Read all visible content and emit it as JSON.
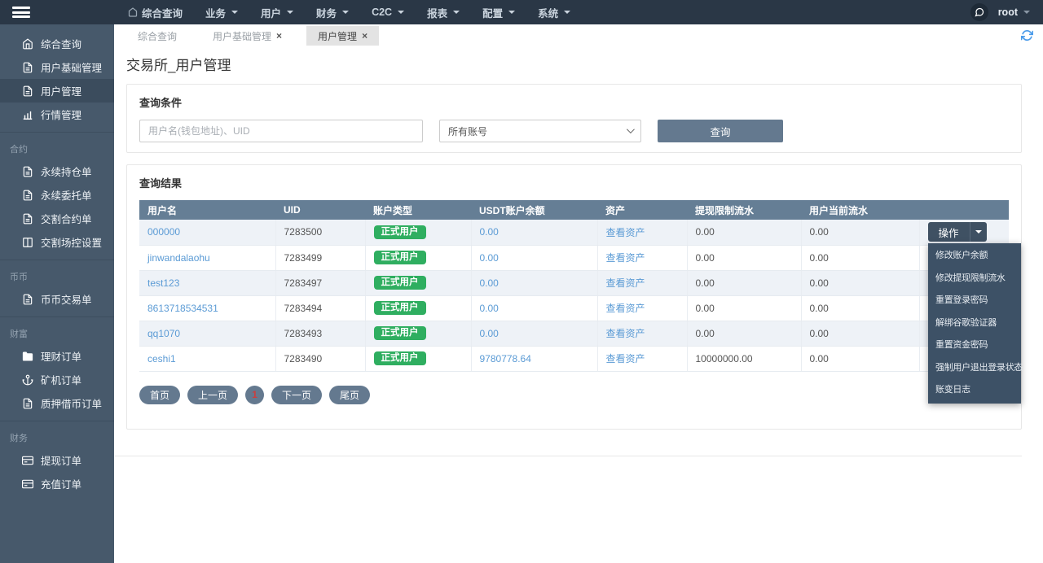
{
  "navbar": {
    "items": [
      {
        "label": "综合查询"
      },
      {
        "label": "业务"
      },
      {
        "label": "用户"
      },
      {
        "label": "财务"
      },
      {
        "label": "C2C"
      },
      {
        "label": "报表"
      },
      {
        "label": "配置"
      },
      {
        "label": "系统"
      }
    ],
    "username": "root"
  },
  "sidebar": {
    "groups": [
      {
        "label": "",
        "items": [
          {
            "label": "综合查询",
            "icon": "home"
          },
          {
            "label": "用户基础管理",
            "icon": "file-text"
          },
          {
            "label": "用户管理",
            "icon": "file-text",
            "active": true
          },
          {
            "label": "行情管理",
            "icon": "bar-chart"
          }
        ]
      },
      {
        "label": "合约",
        "items": [
          {
            "label": "永续持仓单",
            "icon": "file-text"
          },
          {
            "label": "永续委托单",
            "icon": "file-text"
          },
          {
            "label": "交割合约单",
            "icon": "file-text"
          },
          {
            "label": "交割场控设置",
            "icon": "columns"
          }
        ]
      },
      {
        "label": "币币",
        "items": [
          {
            "label": "币币交易单",
            "icon": "file-text"
          }
        ]
      },
      {
        "label": "财富",
        "items": [
          {
            "label": "理财订单",
            "icon": "folder"
          },
          {
            "label": "矿机订单",
            "icon": "anchor"
          },
          {
            "label": "质押借币订单",
            "icon": "file-text"
          }
        ]
      },
      {
        "label": "财务",
        "items": [
          {
            "label": "提现订单",
            "icon": "credit-card"
          },
          {
            "label": "充值订单",
            "icon": "credit-card"
          }
        ]
      }
    ]
  },
  "tabs": {
    "items": [
      {
        "label": "综合查询",
        "closable": false,
        "active": false
      },
      {
        "label": "用户基础管理",
        "closable": true,
        "active": false
      },
      {
        "label": "用户管理",
        "closable": true,
        "active": true
      }
    ]
  },
  "icons": {
    "close": "×"
  },
  "page_title": "交易所_用户管理",
  "search_panel": {
    "title": "查询条件",
    "keyword_placeholder": "用户名(钱包地址)、UID",
    "account_filter_value": "所有账号",
    "search_button_label": "查询"
  },
  "results_panel": {
    "title": "查询结果",
    "columns": [
      "用户名",
      "UID",
      "账户类型",
      "USDT账户余额",
      "资产",
      "提现限制流水",
      "用户当前流水",
      ""
    ],
    "action_button_label": "操作",
    "rows": [
      {
        "username": "000000",
        "uid": "7283500",
        "account_type": "正式用户",
        "usdt_balance": "0.00",
        "assets_link": "查看资产",
        "withdraw_limit_flow": "0.00",
        "current_flow": "0.00"
      },
      {
        "username": "jinwandalaohu",
        "uid": "7283499",
        "account_type": "正式用户",
        "usdt_balance": "0.00",
        "assets_link": "查看资产",
        "withdraw_limit_flow": "0.00",
        "current_flow": "0.00"
      },
      {
        "username": "test123",
        "uid": "7283497",
        "account_type": "正式用户",
        "usdt_balance": "0.00",
        "assets_link": "查看资产",
        "withdraw_limit_flow": "0.00",
        "current_flow": "0.00"
      },
      {
        "username": "8613718534531",
        "uid": "7283494",
        "account_type": "正式用户",
        "usdt_balance": "0.00",
        "assets_link": "查看资产",
        "withdraw_limit_flow": "0.00",
        "current_flow": "0.00"
      },
      {
        "username": "qq1070",
        "uid": "7283493",
        "account_type": "正式用户",
        "usdt_balance": "0.00",
        "assets_link": "查看资产",
        "withdraw_limit_flow": "0.00",
        "current_flow": "0.00"
      },
      {
        "username": "ceshi1",
        "uid": "7283490",
        "account_type": "正式用户",
        "usdt_balance": "9780778.64",
        "assets_link": "查看资产",
        "withdraw_limit_flow": "10000000.00",
        "current_flow": "0.00"
      }
    ],
    "action_menu": [
      "修改账户余额",
      "修改提现限制流水",
      "重置登录密码",
      "解绑谷歌验证器",
      "重置资金密码",
      "强制用户退出登录状态",
      "账变日志"
    ]
  },
  "pagination": {
    "first_label": "首页",
    "prev_label": "上一页",
    "current_page": "1",
    "next_label": "下一页",
    "last_label": "尾页"
  },
  "colors": {
    "navbar_dark": "#2a3746",
    "sidebar_slate": "#47596b",
    "table_header_slate": "#657e95",
    "button_slate": "#64798f",
    "badge_green": "#2fae60",
    "link_blue": "#5b9bd5",
    "current_page_red": "#cc3e3e",
    "refresh_blue": "#4a9bea"
  }
}
